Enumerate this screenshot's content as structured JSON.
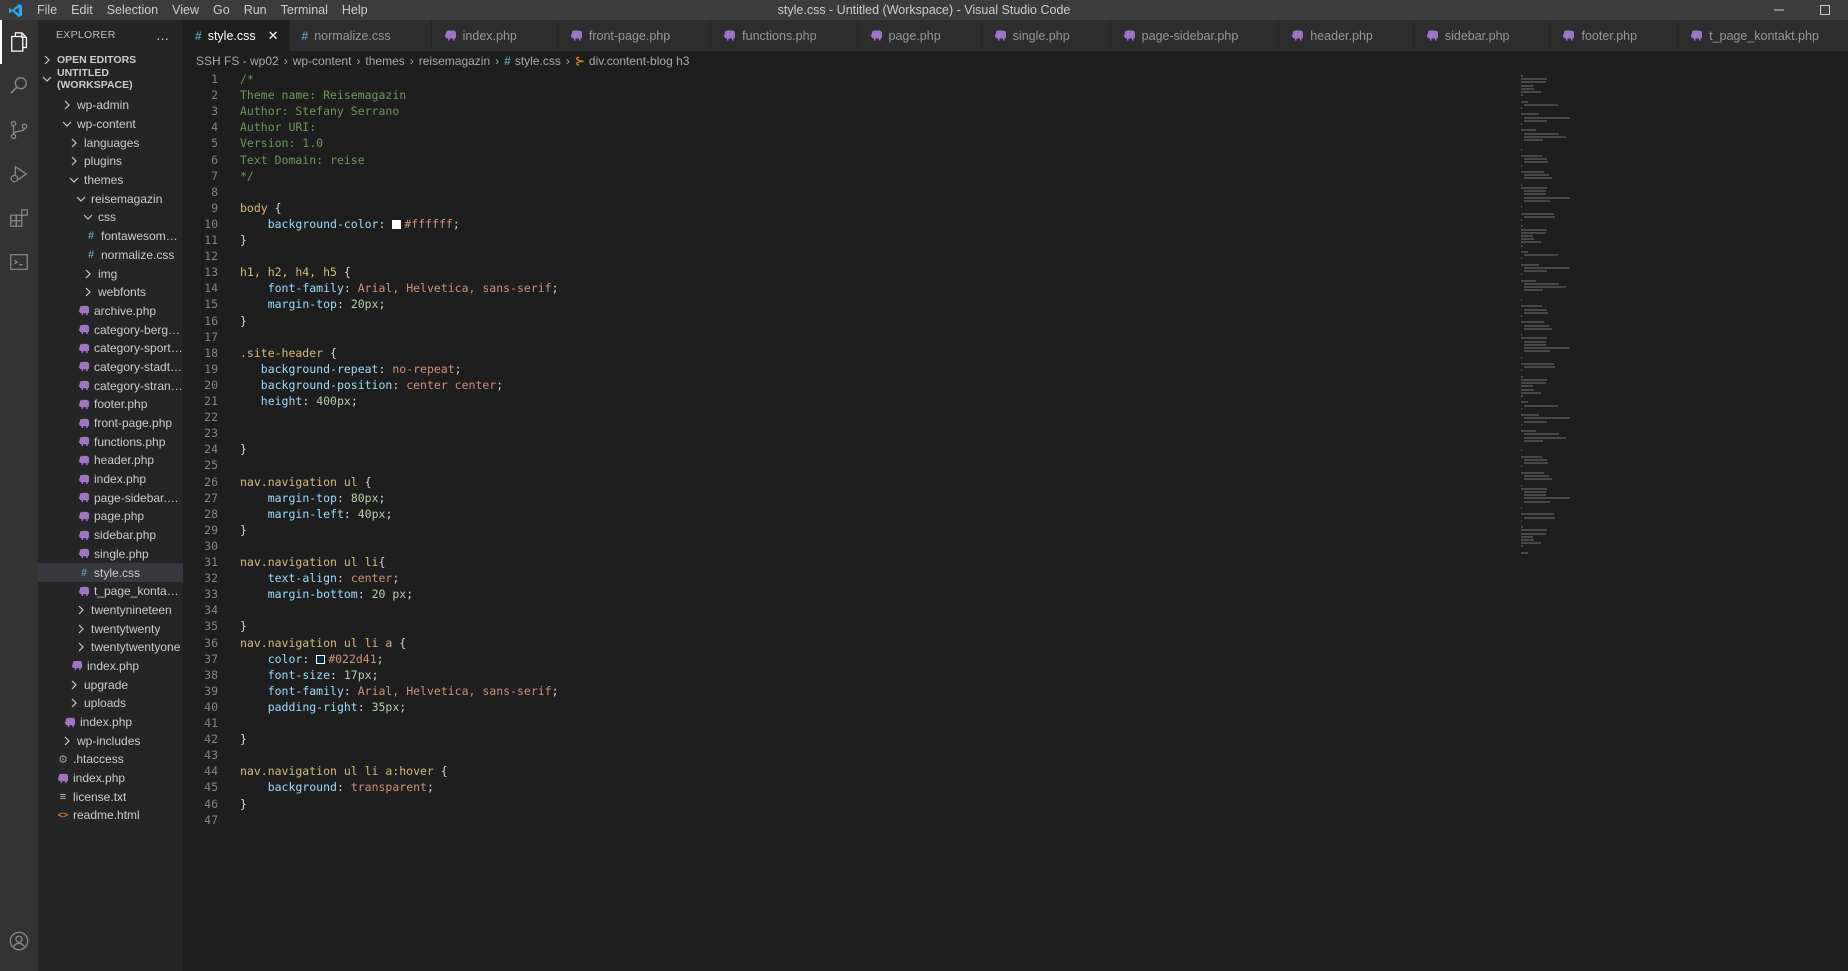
{
  "window": {
    "title": "style.css - Untitled (Workspace) - Visual Studio Code",
    "menu": [
      "File",
      "Edit",
      "Selection",
      "View",
      "Go",
      "Run",
      "Terminal",
      "Help"
    ]
  },
  "sidebar": {
    "title": "EXPLORER",
    "more_icon": "...",
    "open_editors": "OPEN EDITORS",
    "workspace": "UNTITLED (WORKSPACE)",
    "tree": [
      {
        "label": "wp-admin",
        "indent": 1,
        "kind": "folder",
        "open": false
      },
      {
        "label": "wp-content",
        "indent": 1,
        "kind": "folder",
        "open": true
      },
      {
        "label": "languages",
        "indent": 2,
        "kind": "folder",
        "open": false
      },
      {
        "label": "plugins",
        "indent": 2,
        "kind": "folder",
        "open": false
      },
      {
        "label": "themes",
        "indent": 2,
        "kind": "folder",
        "open": true
      },
      {
        "label": "reisemagazin",
        "indent": 3,
        "kind": "folder",
        "open": true
      },
      {
        "label": "css",
        "indent": 4,
        "kind": "folder",
        "open": true
      },
      {
        "label": "fontawesome....",
        "indent": 5,
        "kind": "css"
      },
      {
        "label": "normalize.css",
        "indent": 5,
        "kind": "css"
      },
      {
        "label": "img",
        "indent": 4,
        "kind": "folder",
        "open": false
      },
      {
        "label": "webfonts",
        "indent": 4,
        "kind": "folder",
        "open": false
      },
      {
        "label": "archive.php",
        "indent": 4,
        "kind": "php"
      },
      {
        "label": "category-berge...",
        "indent": 4,
        "kind": "php"
      },
      {
        "label": "category-sport....",
        "indent": 4,
        "kind": "php"
      },
      {
        "label": "category-stadtr...",
        "indent": 4,
        "kind": "php"
      },
      {
        "label": "category-strand...",
        "indent": 4,
        "kind": "php"
      },
      {
        "label": "footer.php",
        "indent": 4,
        "kind": "php"
      },
      {
        "label": "front-page.php",
        "indent": 4,
        "kind": "php"
      },
      {
        "label": "functions.php",
        "indent": 4,
        "kind": "php"
      },
      {
        "label": "header.php",
        "indent": 4,
        "kind": "php"
      },
      {
        "label": "index.php",
        "indent": 4,
        "kind": "php"
      },
      {
        "label": "page-sidebar.php",
        "indent": 4,
        "kind": "php"
      },
      {
        "label": "page.php",
        "indent": 4,
        "kind": "php"
      },
      {
        "label": "sidebar.php",
        "indent": 4,
        "kind": "php"
      },
      {
        "label": "single.php",
        "indent": 4,
        "kind": "php"
      },
      {
        "label": "style.css",
        "indent": 4,
        "kind": "css",
        "selected": true
      },
      {
        "label": "t_page_kontakt....",
        "indent": 4,
        "kind": "php"
      },
      {
        "label": "twentynineteen",
        "indent": 3,
        "kind": "folder",
        "open": false
      },
      {
        "label": "twentytwenty",
        "indent": 3,
        "kind": "folder",
        "open": false
      },
      {
        "label": "twentytwentyone",
        "indent": 3,
        "kind": "folder",
        "open": false
      },
      {
        "label": "index.php",
        "indent": 3,
        "kind": "php"
      },
      {
        "label": "upgrade",
        "indent": 2,
        "kind": "folder",
        "open": false
      },
      {
        "label": "uploads",
        "indent": 2,
        "kind": "folder",
        "open": false
      },
      {
        "label": "index.php",
        "indent": 2,
        "kind": "php"
      },
      {
        "label": "wp-includes",
        "indent": 1,
        "kind": "folder",
        "open": false
      },
      {
        "label": ".htaccess",
        "indent": 1,
        "kind": "gear"
      },
      {
        "label": "index.php",
        "indent": 1,
        "kind": "php"
      },
      {
        "label": "license.txt",
        "indent": 1,
        "kind": "txt"
      },
      {
        "label": "readme.html",
        "indent": 1,
        "kind": "html"
      }
    ]
  },
  "tabs": [
    {
      "label": "style.css",
      "kind": "css",
      "active": true
    },
    {
      "label": "normalize.css",
      "kind": "css"
    },
    {
      "label": "index.php",
      "kind": "php"
    },
    {
      "label": "front-page.php",
      "kind": "php"
    },
    {
      "label": "functions.php",
      "kind": "php"
    },
    {
      "label": "page.php",
      "kind": "php"
    },
    {
      "label": "single.php",
      "kind": "php"
    },
    {
      "label": "page-sidebar.php",
      "kind": "php"
    },
    {
      "label": "header.php",
      "kind": "php"
    },
    {
      "label": "sidebar.php",
      "kind": "php"
    },
    {
      "label": "footer.php",
      "kind": "php"
    },
    {
      "label": "t_page_kontakt.php",
      "kind": "php"
    }
  ],
  "breadcrumb": [
    "SSH FS - wp02",
    "wp-content",
    "themes",
    "reisemagazin",
    "style.css",
    "div.content-blog h3"
  ],
  "editor": {
    "lines": [
      [
        [
          "/*",
          "comment"
        ]
      ],
      [
        [
          "Theme name: Reisemagazin",
          "comment"
        ]
      ],
      [
        [
          "Author: Stefany Serrano",
          "comment"
        ]
      ],
      [
        [
          "Author URI:",
          "comment"
        ]
      ],
      [
        [
          "Version: 1.0",
          "comment"
        ]
      ],
      [
        [
          "Text Domain: reise",
          "comment"
        ]
      ],
      [
        [
          "*/",
          "comment"
        ]
      ],
      [],
      [
        [
          "body",
          "sel"
        ],
        [
          " {",
          "punc"
        ]
      ],
      [
        [
          "    ",
          "punc"
        ],
        [
          "background-color",
          "prop"
        ],
        [
          ": ",
          "punc"
        ],
        [
          "#ffffff",
          "swatch"
        ],
        [
          "#ffffff",
          "val"
        ],
        [
          ";",
          "punc"
        ]
      ],
      [
        [
          "}",
          "punc"
        ]
      ],
      [],
      [
        [
          "h1, h2, h4, h5",
          "sel"
        ],
        [
          " {",
          "punc"
        ]
      ],
      [
        [
          "    ",
          "punc"
        ],
        [
          "font-family",
          "prop"
        ],
        [
          ": ",
          "punc"
        ],
        [
          "Arial, Helvetica, sans-serif",
          "val"
        ],
        [
          ";",
          "punc"
        ]
      ],
      [
        [
          "    ",
          "punc"
        ],
        [
          "margin-top",
          "prop"
        ],
        [
          ": ",
          "punc"
        ],
        [
          "20px",
          "num"
        ],
        [
          ";",
          "punc"
        ]
      ],
      [
        [
          "}",
          "punc"
        ]
      ],
      [],
      [
        [
          ".site-header",
          "sel"
        ],
        [
          " {",
          "punc"
        ]
      ],
      [
        [
          "   ",
          "punc"
        ],
        [
          "background-repeat",
          "prop"
        ],
        [
          ": ",
          "punc"
        ],
        [
          "no-repeat",
          "val"
        ],
        [
          ";",
          "punc"
        ]
      ],
      [
        [
          "   ",
          "punc"
        ],
        [
          "background-position",
          "prop"
        ],
        [
          ": ",
          "punc"
        ],
        [
          "center center",
          "val"
        ],
        [
          ";",
          "punc"
        ]
      ],
      [
        [
          "   ",
          "punc"
        ],
        [
          "height",
          "prop"
        ],
        [
          ": ",
          "punc"
        ],
        [
          "400px",
          "num"
        ],
        [
          ";",
          "punc"
        ]
      ],
      [],
      [],
      [
        [
          "}",
          "punc"
        ]
      ],
      [],
      [
        [
          "nav.navigation ul",
          "sel"
        ],
        [
          " {",
          "punc"
        ]
      ],
      [
        [
          "    ",
          "punc"
        ],
        [
          "margin-top",
          "prop"
        ],
        [
          ": ",
          "punc"
        ],
        [
          "80px",
          "num"
        ],
        [
          ";",
          "punc"
        ]
      ],
      [
        [
          "    ",
          "punc"
        ],
        [
          "margin-left",
          "prop"
        ],
        [
          ": ",
          "punc"
        ],
        [
          "40px",
          "num"
        ],
        [
          ";",
          "punc"
        ]
      ],
      [
        [
          "}",
          "punc"
        ]
      ],
      [],
      [
        [
          "nav.navigation ul li",
          "sel"
        ],
        [
          "{",
          "punc"
        ]
      ],
      [
        [
          "    ",
          "punc"
        ],
        [
          "text-align",
          "prop"
        ],
        [
          ": ",
          "punc"
        ],
        [
          "center",
          "val"
        ],
        [
          ";",
          "punc"
        ]
      ],
      [
        [
          "    ",
          "punc"
        ],
        [
          "margin-bottom",
          "prop"
        ],
        [
          ": ",
          "punc"
        ],
        [
          "20 px",
          "num"
        ],
        [
          ";",
          "punc"
        ]
      ],
      [],
      [
        [
          "}",
          "punc"
        ]
      ],
      [
        [
          "nav.navigation ul li a",
          "sel"
        ],
        [
          " {",
          "punc"
        ]
      ],
      [
        [
          "    ",
          "punc"
        ],
        [
          "color",
          "prop"
        ],
        [
          ": ",
          "punc"
        ],
        [
          "#022d41",
          "swatch"
        ],
        [
          "#022d41",
          "val"
        ],
        [
          ";",
          "punc"
        ]
      ],
      [
        [
          "    ",
          "punc"
        ],
        [
          "font-size",
          "prop"
        ],
        [
          ": ",
          "punc"
        ],
        [
          "17px",
          "num"
        ],
        [
          ";",
          "punc"
        ]
      ],
      [
        [
          "    ",
          "punc"
        ],
        [
          "font-family",
          "prop"
        ],
        [
          ": ",
          "punc"
        ],
        [
          "Arial, Helvetica, sans-serif",
          "val"
        ],
        [
          ";",
          "punc"
        ]
      ],
      [
        [
          "    ",
          "punc"
        ],
        [
          "padding-right",
          "prop"
        ],
        [
          ": ",
          "punc"
        ],
        [
          "35px",
          "num"
        ],
        [
          ";",
          "punc"
        ]
      ],
      [],
      [
        [
          "}",
          "punc"
        ]
      ],
      [],
      [
        [
          "nav.navigation ul li a:hover",
          "sel"
        ],
        [
          " {",
          "punc"
        ]
      ],
      [
        [
          "    ",
          "punc"
        ],
        [
          "background",
          "prop"
        ],
        [
          ": ",
          "punc"
        ],
        [
          "transparent",
          "val"
        ],
        [
          ";",
          "punc"
        ]
      ],
      [
        [
          "}",
          "punc"
        ]
      ],
      []
    ]
  },
  "colors": {
    "titlebar": "#3c3c3c",
    "activitybar": "#333333",
    "sidebar": "#252526",
    "editor": "#1e1e1e",
    "php_icon": "#a074c4",
    "css_icon": "#519aba",
    "vscode_blue": "#23a9f2"
  }
}
